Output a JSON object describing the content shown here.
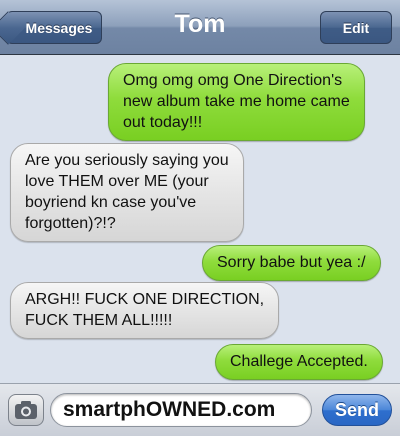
{
  "navbar": {
    "back_label": "Messages",
    "title": "Tom",
    "edit_label": "Edit"
  },
  "messages": [
    {
      "direction": "sent",
      "text": "Omg omg omg One Direction's\nnew album take me home came\nout today!!!"
    },
    {
      "direction": "received",
      "text": "Are you seriously saying you\nlove THEM over ME (your\nboyriend kn case you've\nforgotten)?!?"
    },
    {
      "direction": "sent",
      "text": "Sorry babe but yea :/"
    },
    {
      "direction": "received",
      "text": "ARGH!! FUCK ONE DIRECTION,\nFUCK THEM ALL!!!!!"
    },
    {
      "direction": "sent",
      "text": "Challege Accepted."
    }
  ],
  "compose": {
    "camera_icon": "camera-icon",
    "input_value": "smartphOWNED.com",
    "send_label": "Send"
  },
  "colors": {
    "sent_bubble": "#8fdc3c",
    "received_bubble": "#e5e5e5",
    "background": "#dbe2ed",
    "navbar": "#7489a8",
    "send_button": "#2e6fce"
  }
}
